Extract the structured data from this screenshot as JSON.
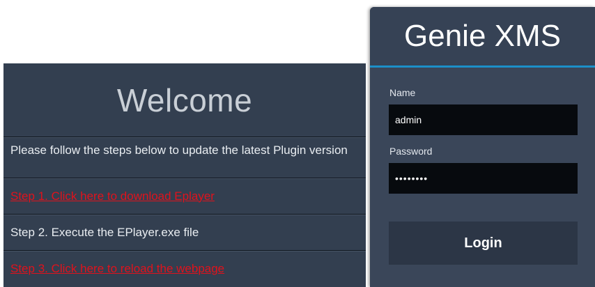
{
  "welcome": {
    "title": "Welcome",
    "intro": "Please follow the steps below to update the latest Plugin version",
    "step1": "Step 1. Click here to download Eplayer",
    "step2": "Step 2. Execute the EPlayer.exe file",
    "step3": "Step 3. Click here to reload the webpage"
  },
  "login": {
    "title": "Genie XMS",
    "name_label": "Name",
    "name_value": "admin",
    "password_label": "Password",
    "password_value": "password",
    "button_label": "Login"
  },
  "colors": {
    "panel_bg": "#333f50",
    "link": "#e0121c",
    "accent": "#1c8fc9",
    "input_bg": "#070a0e"
  }
}
